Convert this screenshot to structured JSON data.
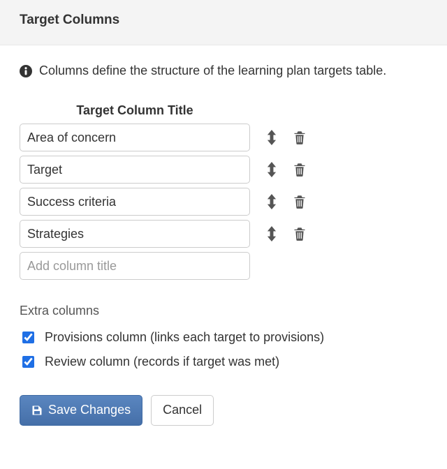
{
  "header": {
    "title": "Target Columns"
  },
  "info": {
    "text": "Columns define the structure of the learning plan targets table."
  },
  "columns": {
    "header_label": "Target Column Title",
    "items": [
      {
        "value": "Area of concern"
      },
      {
        "value": "Target"
      },
      {
        "value": "Success criteria"
      },
      {
        "value": "Strategies"
      }
    ],
    "add_placeholder": "Add column title"
  },
  "extra": {
    "heading": "Extra columns",
    "provisions": {
      "label": "Provisions column (links each target to provisions)",
      "checked": true
    },
    "review": {
      "label": "Review column (records if target was met)",
      "checked": true
    }
  },
  "buttons": {
    "save": "Save Changes",
    "cancel": "Cancel"
  }
}
